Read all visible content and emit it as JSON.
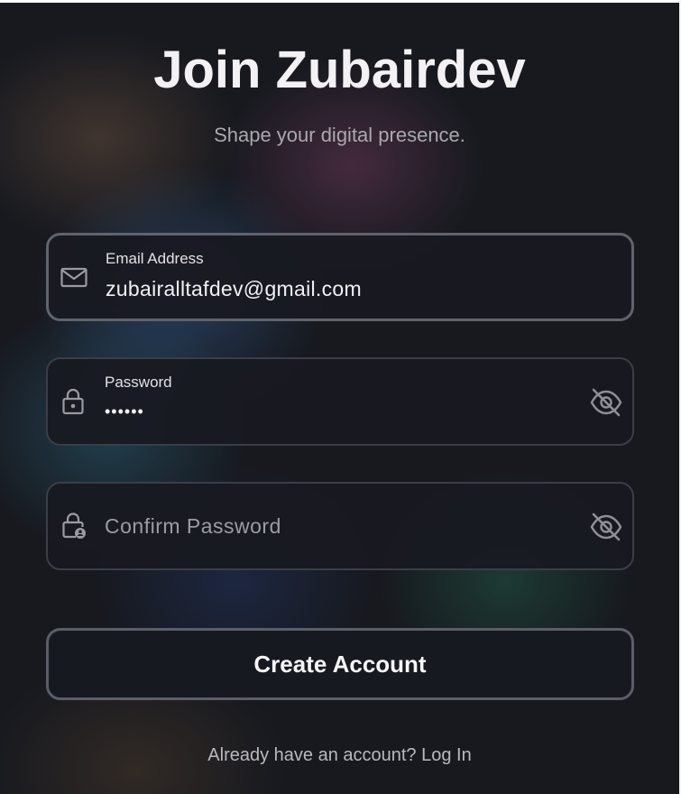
{
  "header": {
    "title": "Join Zubairdev",
    "subtitle": "Shape your digital presence."
  },
  "form": {
    "email": {
      "label": "Email Address",
      "value": "zubairalltafdev@gmail.com",
      "icon": "mail-icon"
    },
    "password": {
      "label": "Password",
      "value": "••••••",
      "icon": "lock-icon",
      "toggle_icon": "eye-off-icon"
    },
    "confirm_password": {
      "placeholder": "Confirm Password",
      "value": "",
      "icon": "lock-person-icon",
      "toggle_icon": "eye-off-icon"
    },
    "submit_label": "Create Account"
  },
  "footer": {
    "prompt": "Already have an account? ",
    "link_label": "Log In"
  },
  "colors": {
    "background": "#17191f",
    "field_background": "#181a21",
    "border_focused": "#5f636c",
    "text_primary": "#f3f1f3",
    "text_muted": "#a9a9ae"
  }
}
